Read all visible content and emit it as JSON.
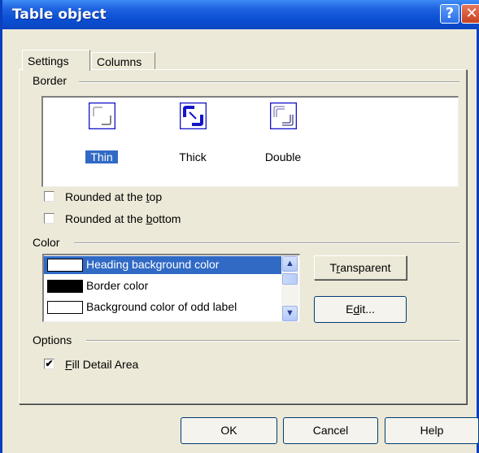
{
  "window": {
    "title": "Table object"
  },
  "titlebar": {
    "help_glyph": "?",
    "close_glyph": "✕"
  },
  "tabs": [
    {
      "label": "Settings",
      "active": true
    },
    {
      "label": "Columns",
      "active": false
    }
  ],
  "border": {
    "group_label": "Border",
    "styles": [
      {
        "label": "Thin",
        "selected": true
      },
      {
        "label": "Thick",
        "selected": false
      },
      {
        "label": "Double",
        "selected": false
      }
    ],
    "rounded_top": {
      "label_pre": "Rounded at the ",
      "label_key": "t",
      "label_post": "op",
      "checked": false
    },
    "rounded_bottom": {
      "label_pre": "Rounded at the ",
      "label_key": "b",
      "label_post": "ottom",
      "checked": false
    }
  },
  "color": {
    "group_label": "Color",
    "items": [
      {
        "label": "Heading background color",
        "swatch": "#ffffff",
        "selected": true
      },
      {
        "label": "Border color",
        "swatch": "#000000",
        "selected": false
      },
      {
        "label": "Background color of odd label",
        "swatch": "#ffffff",
        "selected": false
      }
    ],
    "transparent_pre": "T",
    "transparent_key": "r",
    "transparent_post": "ansparent",
    "edit_pre": "E",
    "edit_key": "d",
    "edit_post": "it..."
  },
  "options": {
    "group_label": "Options",
    "fill_detail": {
      "label_key": "F",
      "label_post": "ill Detail Area",
      "checked": true,
      "mark": "✔"
    }
  },
  "buttons": {
    "ok": "OK",
    "cancel": "Cancel",
    "help": "Help"
  },
  "colors": {
    "selection": "#316ac5",
    "titlebar": "#0b4fd3",
    "dialog_bg": "#ece9d8",
    "icon_blue": "#1414c8"
  }
}
